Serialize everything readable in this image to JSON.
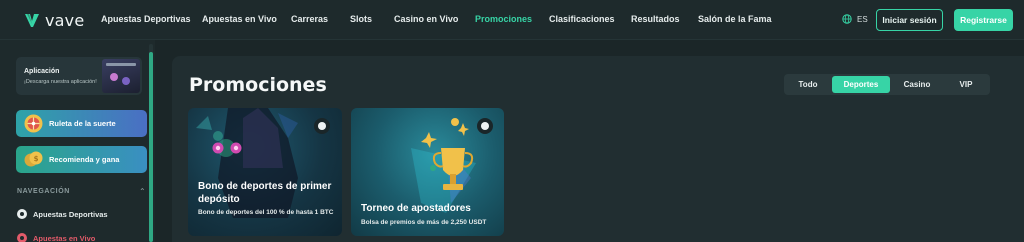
{
  "brand": {
    "name": "vave"
  },
  "nav": {
    "items": [
      {
        "label": "Apuestas Deportivas",
        "active": false
      },
      {
        "label": "Apuestas en Vivo",
        "active": false
      },
      {
        "label": "Carreras",
        "active": false
      },
      {
        "label": "Slots",
        "active": false
      },
      {
        "label": "Casino en Vivo",
        "active": false
      },
      {
        "label": "Promociones",
        "active": true
      },
      {
        "label": "Clasificaciones",
        "active": false
      },
      {
        "label": "Resultados",
        "active": false
      },
      {
        "label": "Salón de la Fama",
        "active": false
      }
    ],
    "language": "ES",
    "login_label": "Iniciar sesión",
    "register_label": "Registrarse"
  },
  "sidebar": {
    "app_card": {
      "title": "Aplicación",
      "subtitle": "¡Descarga nuestra aplicación!"
    },
    "ruleta_label": "Ruleta de la suerte",
    "recomienda_label": "Recomienda y gana",
    "section_heading": "NAVEGACIÓN",
    "items": [
      {
        "label": "Apuestas Deportivas",
        "icon": "soccer-ball-icon"
      },
      {
        "label": "Apuestas en Vivo",
        "icon": "live-icon"
      }
    ]
  },
  "main": {
    "title": "Promociones",
    "tabs": [
      {
        "label": "Todo",
        "selected": false
      },
      {
        "label": "Deportes",
        "selected": true
      },
      {
        "label": "Casino",
        "selected": false
      },
      {
        "label": "VIP",
        "selected": false
      }
    ],
    "cards": [
      {
        "title": "Bono de deportes de primer depósito",
        "description": "Bono de deportes del 100 % de hasta 1 BTC",
        "icon": "soccer-ball-icon"
      },
      {
        "title": "Torneo de apostadores",
        "description": "Bolsa de premios de más de 2,250 USDT",
        "icon": "soccer-ball-icon"
      }
    ]
  },
  "colors": {
    "accent": "#37d4a6",
    "background": "#1b2628",
    "panel": "#212e31",
    "live_red": "#e35b6a"
  }
}
